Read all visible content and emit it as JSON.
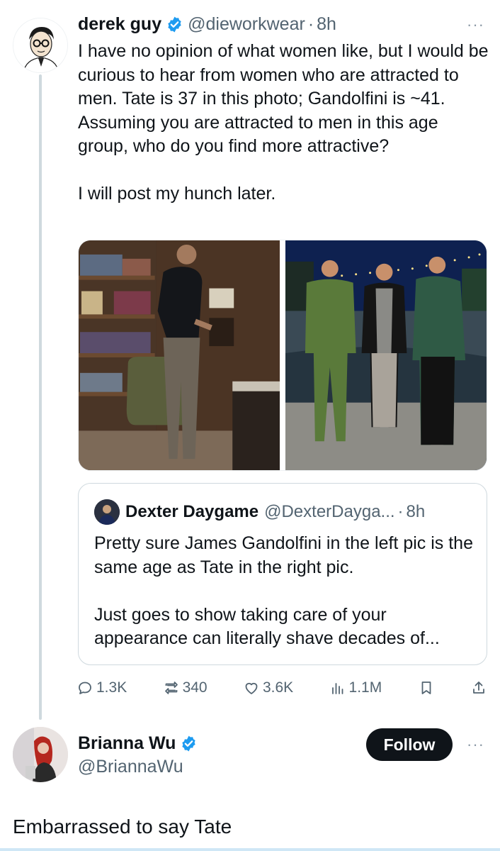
{
  "colors": {
    "verified_blue": "#1d9bf0",
    "text_primary": "#0f1419",
    "text_secondary": "#536471",
    "follow_bg": "#0f1419"
  },
  "tweet1": {
    "name": "derek guy",
    "handle": "@dieworkwear",
    "separator": "·",
    "time": "8h",
    "more_label": "···",
    "text_p1": "I have no opinion of what women like, but I would be curious to hear from women who are attracted to men. Tate is 37 in this photo; Gandolfini is ~41. Assuming you are attracted to men in this age group, who do you find more attractive?",
    "text_p2": "I will post my hunch later.",
    "media": [
      "man-in-office-photo",
      "three-men-in-suits-photo"
    ],
    "quote": {
      "name": "Dexter Daygame",
      "handle": "@DexterDayga...",
      "separator": "·",
      "time": "8h",
      "text_p1": "Pretty sure James Gandolfini in the left pic is the same age as Tate in the right pic.",
      "text_p2": "Just goes to show taking care of your appearance can literally shave decades of..."
    },
    "actions": {
      "replies": "1.3K",
      "reposts": "340",
      "likes": "3.6K",
      "views": "1.1M"
    }
  },
  "tweet2": {
    "name": "Brianna Wu",
    "handle": "@BriannaWu",
    "follow_label": "Follow",
    "more_label": "···",
    "text": "Embarrassed to say Tate"
  }
}
